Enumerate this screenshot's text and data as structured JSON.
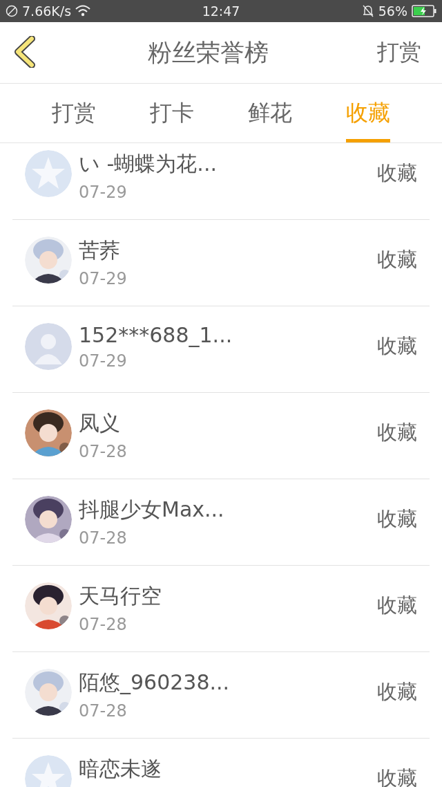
{
  "status_bar": {
    "speed": "7.66K/s",
    "time": "12:47",
    "battery": "56%"
  },
  "header": {
    "title": "粉丝荣誉榜",
    "action": "打赏"
  },
  "tabs": [
    {
      "label": "打赏",
      "selected": false
    },
    {
      "label": "打卡",
      "selected": false
    },
    {
      "label": "鲜花",
      "selected": false
    },
    {
      "label": "收藏",
      "selected": true
    }
  ],
  "rows": [
    {
      "kind": "star",
      "name": "い -蝴蝶为花...",
      "date": "07-29",
      "action": "收藏"
    },
    {
      "kind": "picture",
      "name": "苦荞",
      "date": "07-29",
      "action": "收藏"
    },
    {
      "kind": "person",
      "name": "152***688_1...",
      "date": "07-29",
      "action": "收藏"
    },
    {
      "kind": "picture",
      "name": "凤义",
      "date": "07-28",
      "action": "收藏"
    },
    {
      "kind": "picture",
      "name": "抖腿少女Max...",
      "date": "07-28",
      "action": "收藏"
    },
    {
      "kind": "picture",
      "name": "天马行空",
      "date": "07-28",
      "action": "收藏"
    },
    {
      "kind": "picture",
      "name": "陌悠_960238...",
      "date": "07-28",
      "action": "收藏"
    },
    {
      "kind": "star",
      "name": "暗恋未遂",
      "action": "收藏"
    }
  ]
}
